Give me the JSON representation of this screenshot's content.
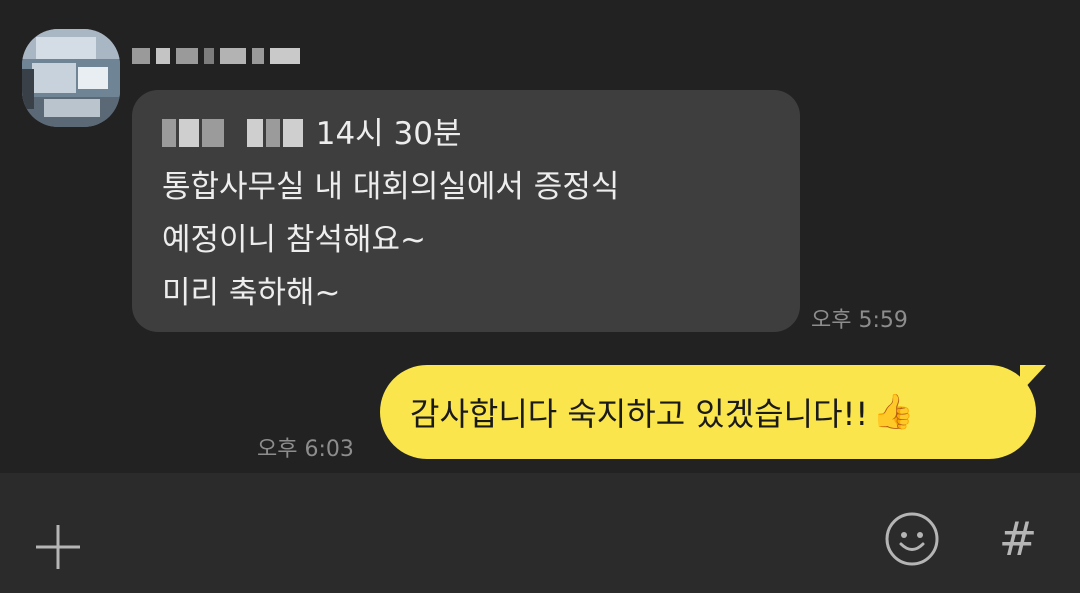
{
  "conversation": {
    "incoming": {
      "sender_name": "",
      "lines": [
        "14시 30분",
        "통합사무실 내 대회의실에서 증정식",
        "예정이니 참석해요~",
        "미리 축하해~"
      ],
      "time": "오후 5:59"
    },
    "outgoing": {
      "text": "감사합니다 숙지하고 있겠습니다!!",
      "emoji": "👍",
      "time": "오후 6:03"
    }
  },
  "input_bar": {
    "icons": [
      "plus-icon",
      "smiley-icon",
      "hash-icon"
    ],
    "hash_symbol": "#"
  },
  "colors": {
    "background": "#222222",
    "incoming_bubble": "#3e3e3e",
    "outgoing_bubble": "#fae54d",
    "bottom_bar": "#2b2b2b",
    "timestamp": "#8d8d8d"
  }
}
